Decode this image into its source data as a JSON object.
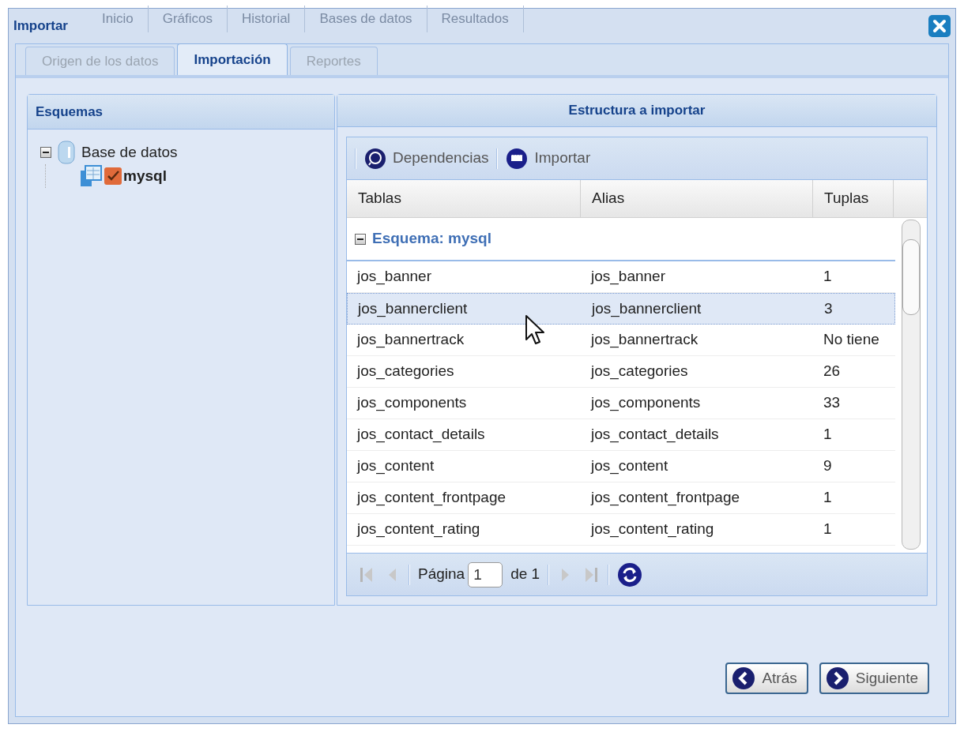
{
  "background_tabs": [
    "Inicio",
    "Gráficos",
    "Historial",
    "Bases de datos",
    "Resultados"
  ],
  "window": {
    "title": "Importar"
  },
  "tabs": [
    {
      "label": "Origen de los datos",
      "selected": false
    },
    {
      "label": "Importación",
      "selected": true
    },
    {
      "label": "Reportes",
      "selected": false
    }
  ],
  "schemas_panel": {
    "title": "Esquemas",
    "tree": [
      {
        "label": "Base de datos",
        "expanded": true,
        "children": [
          {
            "label": "mysql",
            "checked": true
          }
        ]
      }
    ]
  },
  "structure_panel": {
    "title": "Estructura a importar",
    "toolbar": [
      "Dependencias",
      "Importar"
    ],
    "table": {
      "columns": [
        "Tablas",
        "Alias",
        "Tuplas"
      ],
      "group": {
        "label": "Esquema: mysql",
        "expanded": true
      },
      "rows": [
        {
          "cells": [
            "jos_banner",
            "jos_banner",
            "1"
          ],
          "selected": false
        },
        {
          "cells": [
            "jos_bannerclient",
            "jos_bannerclient",
            "3"
          ],
          "selected": true
        },
        {
          "cells": [
            "jos_bannertrack",
            "jos_bannertrack",
            "No tiene"
          ],
          "selected": false
        },
        {
          "cells": [
            "jos_categories",
            "jos_categories",
            "26"
          ],
          "selected": false
        },
        {
          "cells": [
            "jos_components",
            "jos_components",
            "33"
          ],
          "selected": false
        },
        {
          "cells": [
            "jos_contact_details",
            "jos_contact_details",
            "1"
          ],
          "selected": false
        },
        {
          "cells": [
            "jos_content",
            "jos_content",
            "9"
          ],
          "selected": false
        },
        {
          "cells": [
            "jos_content_frontpage",
            "jos_content_frontpage",
            "1"
          ],
          "selected": false
        },
        {
          "cells": [
            "jos_content_rating",
            "jos_content_rating",
            "1"
          ],
          "selected": false
        }
      ]
    },
    "paging": {
      "page_label": "Página",
      "page": "1",
      "of_label": "de 1"
    }
  },
  "buttons": [
    "Atrás",
    "Siguiente"
  ]
}
